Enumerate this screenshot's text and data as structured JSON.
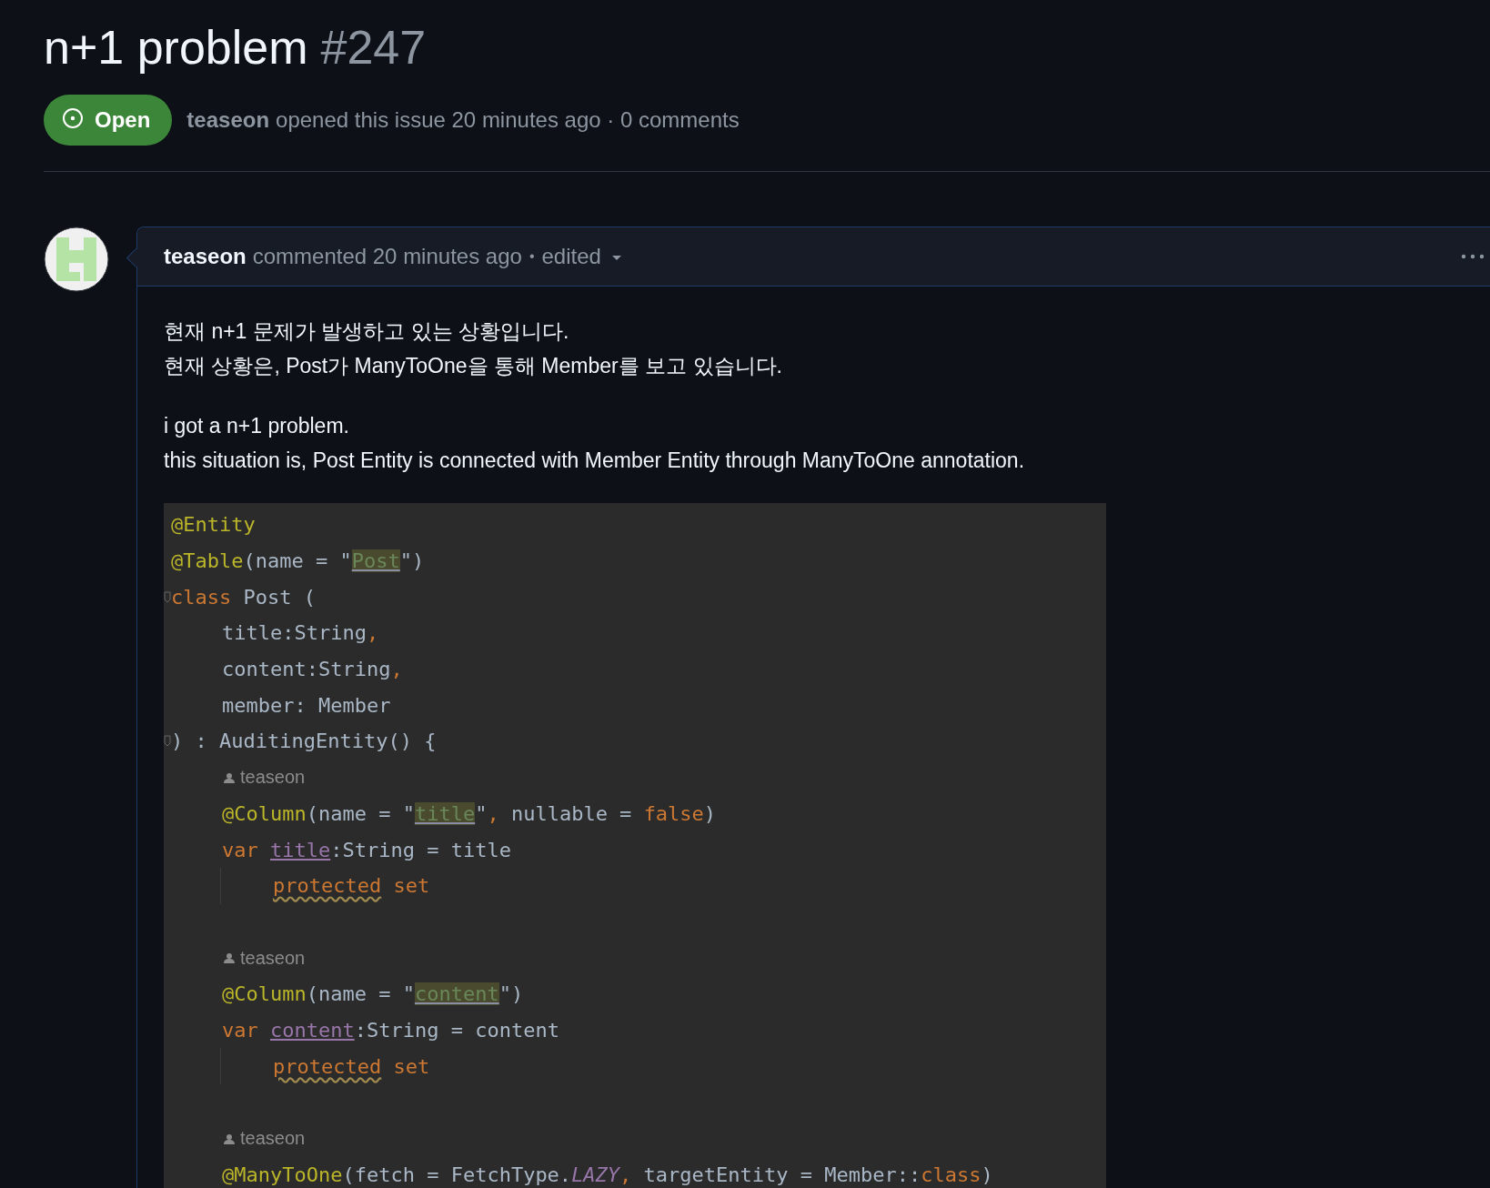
{
  "issue": {
    "title": "n+1 problem",
    "number": "#247",
    "state": {
      "label": "Open",
      "kind": "open"
    },
    "author": "teaseon",
    "meta": "opened this issue 20 minutes ago · 0 comments"
  },
  "comment": {
    "author": "teaseon",
    "meta": "commented 20 minutes ago",
    "separator": "•",
    "edited": "edited",
    "paragraphs": [
      [
        "현재 n+1 문제가 발생하고 있는 상황입니다.",
        "현재 상황은, Post가 ManyToOne을 통해 Member를 보고 있습니다."
      ],
      [
        "i got a n+1 problem.",
        "this situation is, Post Entity is connected with Member Entity through ManyToOne annotation."
      ]
    ],
    "code_lines": [
      {
        "kind": "code",
        "fold": false,
        "guide": false,
        "tokens": [
          {
            "text": "@Entity",
            "kind": "annotation"
          }
        ]
      },
      {
        "kind": "code",
        "fold": false,
        "guide": false,
        "tokens": [
          {
            "text": "@Table",
            "kind": "annotation"
          },
          {
            "text": "(name = \"",
            "kind": "plain"
          },
          {
            "text": "Post",
            "kind": "string-mark"
          },
          {
            "text": "\")",
            "kind": "plain"
          }
        ]
      },
      {
        "kind": "code",
        "fold": true,
        "guide": false,
        "tokens": [
          {
            "text": "class",
            "kind": "keyword"
          },
          {
            "text": " Post (",
            "kind": "plain"
          }
        ]
      },
      {
        "kind": "code-indent",
        "fold": false,
        "guide": false,
        "tokens": [
          {
            "text": "title:String",
            "kind": "plain"
          },
          {
            "text": ",",
            "kind": "keyword"
          }
        ]
      },
      {
        "kind": "code-indent",
        "fold": false,
        "guide": false,
        "tokens": [
          {
            "text": "content:String",
            "kind": "plain"
          },
          {
            "text": ",",
            "kind": "keyword"
          }
        ]
      },
      {
        "kind": "code-indent",
        "fold": false,
        "guide": false,
        "tokens": [
          {
            "text": "member: Member",
            "kind": "plain"
          }
        ]
      },
      {
        "kind": "code",
        "fold": true,
        "guide": false,
        "tokens": [
          {
            "text": ") : AuditingEntity() {",
            "kind": "plain"
          }
        ]
      },
      {
        "kind": "author",
        "name": "teaseon"
      },
      {
        "kind": "code-indent",
        "fold": false,
        "guide": false,
        "tokens": [
          {
            "text": "@Column",
            "kind": "annotation"
          },
          {
            "text": "(name = \"",
            "kind": "plain"
          },
          {
            "text": "title",
            "kind": "string-mark"
          },
          {
            "text": "\"",
            "kind": "plain"
          },
          {
            "text": ",",
            "kind": "keyword"
          },
          {
            "text": " nullable = ",
            "kind": "plain"
          },
          {
            "text": "false",
            "kind": "keyword"
          },
          {
            "text": ")",
            "kind": "plain"
          }
        ]
      },
      {
        "kind": "code-indent",
        "fold": false,
        "guide": false,
        "tokens": [
          {
            "text": "var ",
            "kind": "keyword"
          },
          {
            "text": "title",
            "kind": "property"
          },
          {
            "text": ":String = title",
            "kind": "plain"
          }
        ]
      },
      {
        "kind": "code-indent2",
        "fold": false,
        "guide": true,
        "tokens": [
          {
            "text": "protected",
            "kind": "keyword-warn"
          },
          {
            "text": " set",
            "kind": "keyword"
          }
        ]
      },
      {
        "kind": "blank"
      },
      {
        "kind": "author",
        "name": "teaseon"
      },
      {
        "kind": "code-indent",
        "fold": false,
        "guide": false,
        "tokens": [
          {
            "text": "@Column",
            "kind": "annotation"
          },
          {
            "text": "(name = \"",
            "kind": "plain"
          },
          {
            "text": "content",
            "kind": "string-mark"
          },
          {
            "text": "\")",
            "kind": "plain"
          }
        ]
      },
      {
        "kind": "code-indent",
        "fold": false,
        "guide": false,
        "tokens": [
          {
            "text": "var ",
            "kind": "keyword"
          },
          {
            "text": "content",
            "kind": "property"
          },
          {
            "text": ":String = content",
            "kind": "plain"
          }
        ]
      },
      {
        "kind": "code-indent2",
        "fold": false,
        "guide": true,
        "tokens": [
          {
            "text": "protected",
            "kind": "keyword-warn"
          },
          {
            "text": " set",
            "kind": "keyword"
          }
        ]
      },
      {
        "kind": "blank"
      },
      {
        "kind": "author",
        "name": "teaseon"
      },
      {
        "kind": "code-indent",
        "fold": false,
        "guide": false,
        "tokens": [
          {
            "text": "@ManyToOne",
            "kind": "annotation"
          },
          {
            "text": "(fetch = FetchType.",
            "kind": "plain"
          },
          {
            "text": "LAZY",
            "kind": "italic"
          },
          {
            "text": ",",
            "kind": "keyword"
          },
          {
            "text": " targetEntity = Member::",
            "kind": "plain"
          },
          {
            "text": "class",
            "kind": "keyword"
          },
          {
            "text": ")",
            "kind": "plain"
          }
        ]
      }
    ]
  }
}
